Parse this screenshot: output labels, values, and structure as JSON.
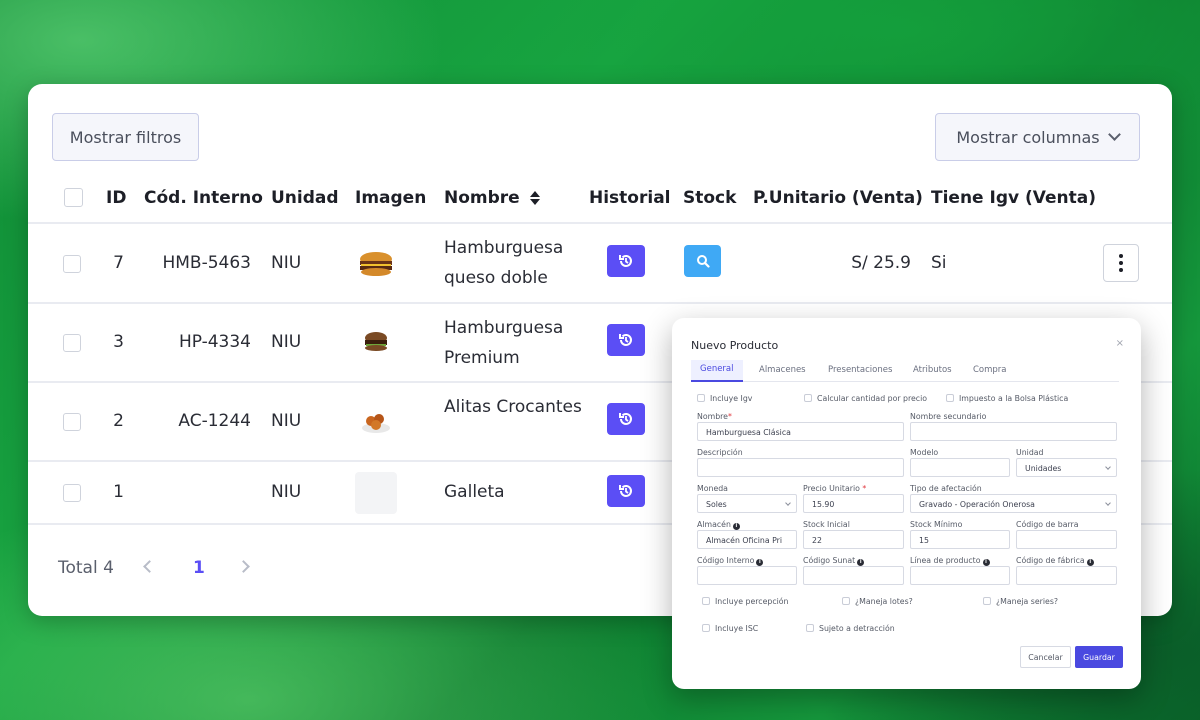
{
  "toolbar": {
    "filters_label": "Mostrar filtros",
    "columns_label": "Mostrar columnas"
  },
  "table": {
    "headers": {
      "id": "ID",
      "internal_code": "Cód. Interno",
      "unit": "Unidad",
      "image": "Imagen",
      "name": "Nombre",
      "history": "Historial",
      "stock": "Stock",
      "unit_price": "P.Unitario (Venta)",
      "igv": "Tiene Igv (Venta)"
    },
    "rows": [
      {
        "id": "7",
        "code": "HMB-5463",
        "unit": "NIU",
        "image": "burger-double",
        "name": "Hamburguesa queso doble",
        "price": "S/ 25.9",
        "igv": "Si"
      },
      {
        "id": "3",
        "code": "HP-4334",
        "unit": "NIU",
        "image": "burger-premium",
        "name": "Hamburguesa Premium",
        "price": "",
        "igv": ""
      },
      {
        "id": "2",
        "code": "AC-1244",
        "unit": "NIU",
        "image": "chicken-wings",
        "name": "Alitas Crocantes",
        "price": "",
        "igv": ""
      },
      {
        "id": "1",
        "code": "",
        "unit": "NIU",
        "image": "empty",
        "name": "Galleta",
        "price": "",
        "igv": ""
      }
    ]
  },
  "pagination": {
    "total": "Total 4",
    "current_page": "1"
  },
  "modal": {
    "title": "Nuevo Producto",
    "close": "×",
    "tabs": [
      "General",
      "Almacenes",
      "Presentaciones",
      "Atributos",
      "Compra"
    ],
    "checks_top": [
      "Incluye Igv",
      "Calcular cantidad por precio",
      "Impuesto a la Bolsa Plástica"
    ],
    "fields": {
      "nombre_label": "Nombre",
      "nombre_value": "Hamburguesa Clásica",
      "nombre_sec_label": "Nombre secundario",
      "descripcion_label": "Descripción",
      "modelo_label": "Modelo",
      "unidad_label": "Unidad",
      "unidad_value": "Unidades",
      "moneda_label": "Moneda",
      "moneda_value": "Soles",
      "precio_label": "Precio Unitario",
      "precio_value": "15.90",
      "afectacion_label": "Tipo de afectación",
      "afectacion_value": "Gravado - Operación Onerosa",
      "almacen_label": "Almacén",
      "almacen_value": "Almacén Oficina Pri",
      "stock_ini_label": "Stock Inicial",
      "stock_ini_value": "22",
      "stock_min_label": "Stock Mínimo",
      "stock_min_value": "15",
      "barra_label": "Código de barra",
      "interno_label": "Código Interno",
      "sunat_label": "Código Sunat",
      "linea_label": "Línea de producto",
      "fabrica_label": "Código de fábrica"
    },
    "checks_bottom": [
      "Incluye percepción",
      "¿Maneja lotes?",
      "¿Maneja series?",
      "Incluye ISC",
      "Sujeto a detracción"
    ],
    "cancel_label": "Cancelar",
    "save_label": "Guardar"
  },
  "colors": {
    "accent": "#5b4ef5",
    "stock_button": "#3fa9f5",
    "background": "#15973c"
  }
}
